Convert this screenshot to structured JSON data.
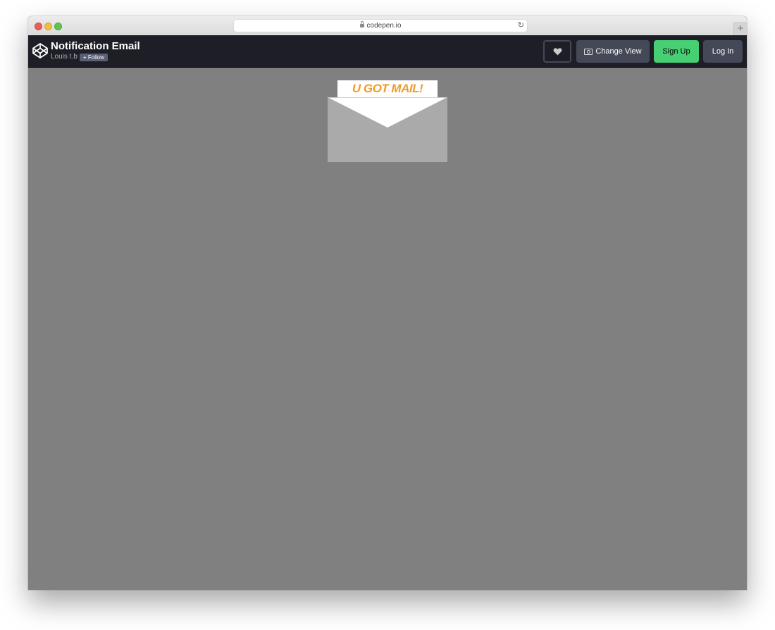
{
  "browser": {
    "url": "codepen.io"
  },
  "header": {
    "title": "Notification Email",
    "author": "Louis t.b",
    "follow_label": "+ Follow",
    "change_view_label": "Change View",
    "signup_label": "Sign Up",
    "login_label": "Log In"
  },
  "preview": {
    "mail_text": "U GOT MAIL!"
  },
  "colors": {
    "header_bg": "#1e1f26",
    "button_gray": "#444857",
    "signup_green": "#47cf73",
    "preview_bg": "#808080",
    "envelope_body": "#aaaaaa",
    "mail_text": "#f19a2b"
  },
  "icons": {
    "logo": "codepen-logo-icon",
    "heart": "heart-icon",
    "change_view": "change-view-icon",
    "lock": "lock-icon",
    "reload": "reload-icon"
  }
}
